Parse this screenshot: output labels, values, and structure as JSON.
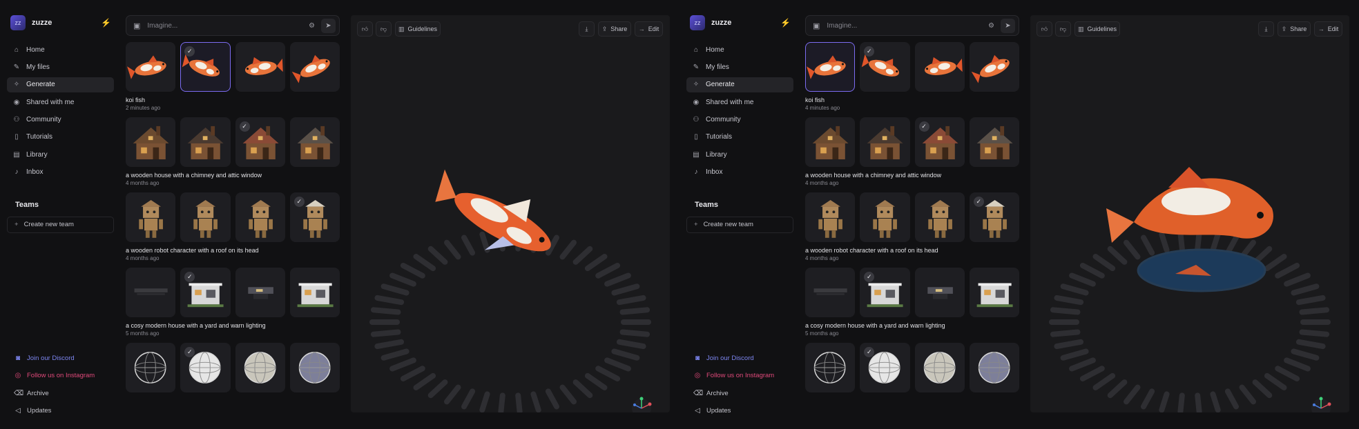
{
  "app": {
    "name": "zuzze",
    "avatar_text": "zz"
  },
  "sidebar": {
    "items": [
      {
        "label": "Home",
        "icon": "home-icon",
        "glyph": "⌂"
      },
      {
        "label": "My files",
        "icon": "pencil-icon",
        "glyph": "✎"
      },
      {
        "label": "Generate",
        "icon": "sparkle-icon",
        "glyph": "✧"
      },
      {
        "label": "Shared with me",
        "icon": "user-circle-icon",
        "glyph": "◉"
      },
      {
        "label": "Community",
        "icon": "users-icon",
        "glyph": "⚇"
      },
      {
        "label": "Tutorials",
        "icon": "book-icon",
        "glyph": "▯"
      },
      {
        "label": "Library",
        "icon": "library-icon",
        "glyph": "▤"
      },
      {
        "label": "Inbox",
        "icon": "bell-icon",
        "glyph": "♪"
      }
    ],
    "active_index": 2,
    "teams_title": "Teams",
    "create_team_label": "Create new team",
    "bottom_links": [
      {
        "label": "Join our Discord",
        "icon": "discord-icon",
        "glyph": "◙",
        "kind": "discord"
      },
      {
        "label": "Follow us on Instagram",
        "icon": "instagram-icon",
        "glyph": "◎",
        "kind": "instagram"
      },
      {
        "label": "Archive",
        "icon": "trash-icon",
        "glyph": "⌫",
        "kind": "plain"
      },
      {
        "label": "Updates",
        "icon": "megaphone-icon",
        "glyph": "◁",
        "kind": "plain"
      }
    ]
  },
  "search": {
    "placeholder": "Imagine..."
  },
  "toolbar": {
    "guidelines_label": "Guidelines",
    "share_label": "Share",
    "edit_label": "Edit"
  },
  "colors": {
    "accent": "#7c6cf2",
    "bolt": "#2fd66d",
    "discord": "#7d86f0",
    "instagram": "#e0497a"
  },
  "screens": [
    {
      "selected_koi": 1,
      "groups": [
        {
          "title": "koi fish",
          "time": "2 minutes ago",
          "kind": "koi",
          "checked": [
            1
          ]
        },
        {
          "title": "a wooden house with a chimney and attic window",
          "time": "4 months ago",
          "kind": "house",
          "checked": [
            2
          ]
        },
        {
          "title": "a wooden robot character with a roof on its head",
          "time": "4 months ago",
          "kind": "robot",
          "checked": [
            3
          ]
        },
        {
          "title": "a cosy modern house with a yard and warn lighting",
          "time": "5 months ago",
          "kind": "modern",
          "checked": [
            1
          ]
        },
        {
          "title": "",
          "time": "",
          "kind": "sphere",
          "checked": [
            1
          ]
        }
      ]
    },
    {
      "selected_koi": 0,
      "groups": [
        {
          "title": "koi fish",
          "time": "4 minutes ago",
          "kind": "koi",
          "checked": [
            1
          ]
        },
        {
          "title": "a wooden house with a chimney and attic window",
          "time": "4 months ago",
          "kind": "house",
          "checked": [
            2
          ]
        },
        {
          "title": "a wooden robot character with a roof on its head",
          "time": "4 months ago",
          "kind": "robot",
          "checked": [
            3
          ]
        },
        {
          "title": "a cosy modern house with a yard and warn lighting",
          "time": "5 months ago",
          "kind": "modern",
          "checked": [
            1
          ]
        },
        {
          "title": "",
          "time": "",
          "kind": "sphere",
          "checked": [
            1
          ]
        }
      ]
    }
  ]
}
